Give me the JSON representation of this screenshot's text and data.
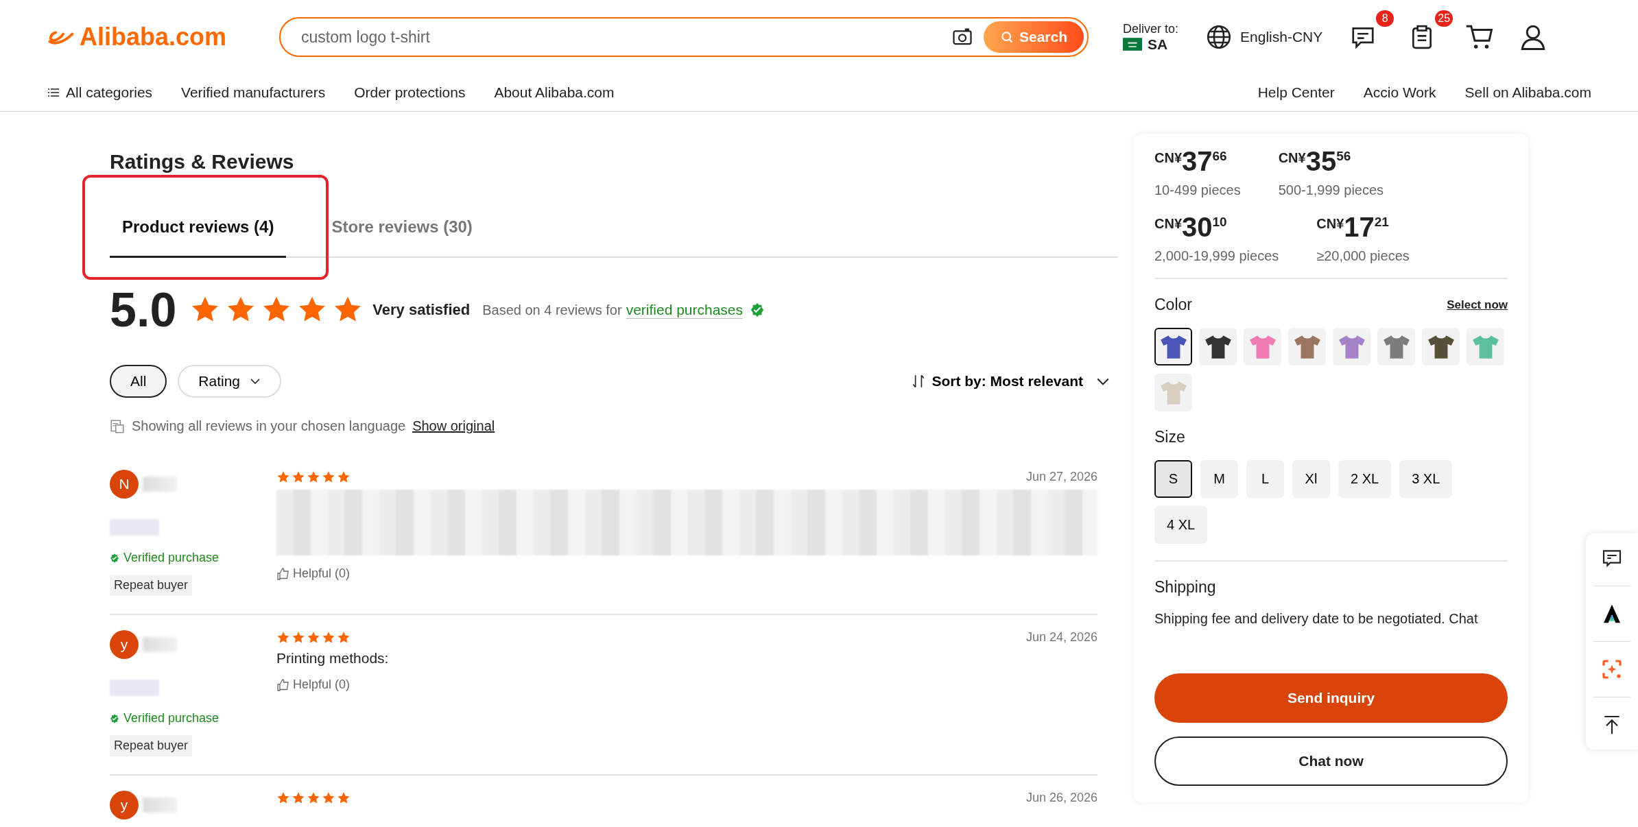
{
  "header": {
    "logo": "Alibaba.com",
    "search": {
      "value": "custom logo t-shirt",
      "button": "Search"
    },
    "deliver": {
      "label": "Deliver to:",
      "country": "SA"
    },
    "language": "English-CNY",
    "message_badge": "8",
    "orders_badge": "25"
  },
  "nav": {
    "left": [
      "All categories",
      "Verified manufacturers",
      "Order protections",
      "About Alibaba.com"
    ],
    "right": [
      "Help Center",
      "Accio Work",
      "Sell on Alibaba.com"
    ]
  },
  "reviews": {
    "title": "Ratings & Reviews",
    "tabs": [
      {
        "label": "Product reviews (4)",
        "selected": true,
        "highlighted": true
      },
      {
        "label": "Store reviews (30)",
        "selected": false,
        "highlighted": false
      }
    ],
    "score": "5.0",
    "stars": 5,
    "verdict": "Very satisfied",
    "based_on": "Based on 4 reviews for",
    "verified_link": "verified purchases",
    "filters": [
      {
        "label": "All",
        "selected": true,
        "dropdown": false
      },
      {
        "label": "Rating",
        "selected": false,
        "dropdown": true
      }
    ],
    "sort": "Sort by: Most relevant",
    "language_note": "Showing all reviews in your chosen language",
    "show_original": "Show original",
    "items": [
      {
        "avatar": "N",
        "stars": 5,
        "date": "Jun 27, 2026",
        "blurred_text": true,
        "verified": "Verified purchase",
        "badge": "Repeat buyer",
        "helpful": "Helpful (0)"
      },
      {
        "avatar": "y",
        "stars": 5,
        "date": "Jun 24, 2026",
        "text": "Printing methods:",
        "blurred_text": false,
        "verified": "Verified purchase",
        "badge": "Repeat buyer",
        "helpful": "Helpful (0)"
      },
      {
        "avatar": "y",
        "stars": 5,
        "date": "Jun 26, 2026",
        "blurred_text": false
      }
    ]
  },
  "panel": {
    "prices": [
      {
        "currency": "CN¥",
        "whole": "37",
        "fraction": "66",
        "range": "10-499 pieces"
      },
      {
        "currency": "CN¥",
        "whole": "35",
        "fraction": "56",
        "range": "500-1,999 pieces"
      },
      {
        "currency": "CN¥",
        "whole": "30",
        "fraction": "10",
        "range": "2,000-19,999 pieces"
      },
      {
        "currency": "CN¥",
        "whole": "17",
        "fraction": "21",
        "range": "≥20,000 pieces"
      }
    ],
    "color": {
      "title": "Color",
      "link": "Select now",
      "swatches": [
        {
          "color": "#4a55b8",
          "selected": true
        },
        {
          "color": "#333333",
          "selected": false
        },
        {
          "color": "#ef7bb5",
          "selected": false
        },
        {
          "color": "#9a7560",
          "selected": false
        },
        {
          "color": "#a483c8",
          "selected": false
        },
        {
          "color": "#7c7c7c",
          "selected": false
        },
        {
          "color": "#56503a",
          "selected": false
        },
        {
          "color": "#5cbf9e",
          "selected": false
        },
        {
          "color": "#d9cfc0",
          "selected": false
        }
      ]
    },
    "size": {
      "title": "Size",
      "options": [
        {
          "label": "S",
          "selected": true
        },
        {
          "label": "M",
          "selected": false
        },
        {
          "label": "L",
          "selected": false
        },
        {
          "label": "Xl",
          "selected": false
        },
        {
          "label": "2 XL",
          "selected": false
        },
        {
          "label": "3 XL",
          "selected": false
        },
        {
          "label": "4 XL",
          "selected": false
        }
      ]
    },
    "shipping": {
      "title": "Shipping",
      "text": "Shipping fee and delivery date to be negotiated. Chat"
    },
    "buttons": {
      "primary": "Send inquiry",
      "secondary": "Chat now"
    }
  }
}
